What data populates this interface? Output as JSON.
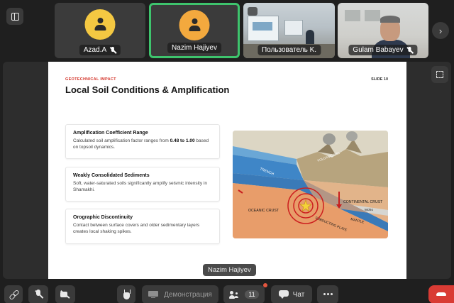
{
  "participants": [
    {
      "name": "Azad.A",
      "muted": true
    },
    {
      "name": "Nazim Hajiyev",
      "muted": false,
      "active_speaker": true
    },
    {
      "name": "Пользователь K.",
      "muted": false
    },
    {
      "name": "Gulam Babayev",
      "muted": true
    }
  ],
  "slide": {
    "eyebrow": "GEOTECHNICAL IMPACT",
    "slide_number": "SLIDE 10",
    "title": "Local Soil Conditions & Amplification",
    "cards": [
      {
        "heading": "Amplification Coefficient Range",
        "text_before": "Calculated soil amplification factor ranges from ",
        "highlight": "0.48 to 1.00",
        "text_after": " based on topsoil dynamics."
      },
      {
        "heading": "Weakly Consolidated Sediments",
        "text": "Soft, water-saturated soils significantly amplify seismic intensity in Shamakhi."
      },
      {
        "heading": "Orographic Discontinuity",
        "text": "Contact between surface covers and older sedimentary layers creates local shaking spikes."
      }
    ],
    "diagram_labels": {
      "trench": "TRENCH",
      "volcanic_arc": "VOLCANIC ARC",
      "oceanic_crust": "OCEANIC CRUST",
      "subducting_plate": "SUBDUCTING PLATE",
      "continental_crust": "CONTINENTAL CRUST",
      "moho": "Moho",
      "mantle": "MANTLE"
    }
  },
  "speaker_label": "Nazim Hajiyev",
  "toolbar": {
    "demo_label": "Демонстрация",
    "participants_count": "11",
    "chat_label": "Чат"
  },
  "colors": {
    "active_speaker_border": "#3ec46d",
    "leave_button": "#d93b34",
    "eyebrow": "#d4352b"
  }
}
